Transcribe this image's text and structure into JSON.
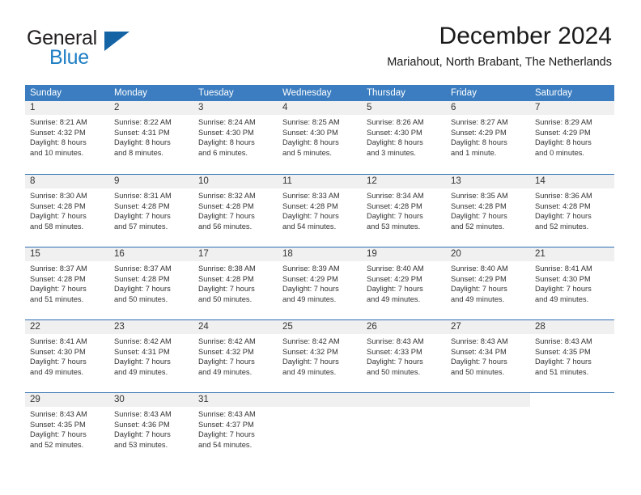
{
  "brand": {
    "word_one": "General",
    "word_two": "Blue",
    "logo_icon": "triangle-logo"
  },
  "header": {
    "title": "December 2024",
    "subtitle": "Mariahout, North Brabant, The Netherlands"
  },
  "colors": {
    "header_blue": "#3b7dc0",
    "rule_blue": "#2f6fb3",
    "band_gray": "#f0f0f0",
    "brand_blue": "#1f7fc4",
    "text": "#333333"
  },
  "weekdays": [
    "Sunday",
    "Monday",
    "Tuesday",
    "Wednesday",
    "Thursday",
    "Friday",
    "Saturday"
  ],
  "weeks": [
    [
      {
        "day": "1",
        "sunrise": "Sunrise: 8:21 AM",
        "sunset": "Sunset: 4:32 PM",
        "daylight1": "Daylight: 8 hours",
        "daylight2": "and 10 minutes."
      },
      {
        "day": "2",
        "sunrise": "Sunrise: 8:22 AM",
        "sunset": "Sunset: 4:31 PM",
        "daylight1": "Daylight: 8 hours",
        "daylight2": "and 8 minutes."
      },
      {
        "day": "3",
        "sunrise": "Sunrise: 8:24 AM",
        "sunset": "Sunset: 4:30 PM",
        "daylight1": "Daylight: 8 hours",
        "daylight2": "and 6 minutes."
      },
      {
        "day": "4",
        "sunrise": "Sunrise: 8:25 AM",
        "sunset": "Sunset: 4:30 PM",
        "daylight1": "Daylight: 8 hours",
        "daylight2": "and 5 minutes."
      },
      {
        "day": "5",
        "sunrise": "Sunrise: 8:26 AM",
        "sunset": "Sunset: 4:30 PM",
        "daylight1": "Daylight: 8 hours",
        "daylight2": "and 3 minutes."
      },
      {
        "day": "6",
        "sunrise": "Sunrise: 8:27 AM",
        "sunset": "Sunset: 4:29 PM",
        "daylight1": "Daylight: 8 hours",
        "daylight2": "and 1 minute."
      },
      {
        "day": "7",
        "sunrise": "Sunrise: 8:29 AM",
        "sunset": "Sunset: 4:29 PM",
        "daylight1": "Daylight: 8 hours",
        "daylight2": "and 0 minutes."
      }
    ],
    [
      {
        "day": "8",
        "sunrise": "Sunrise: 8:30 AM",
        "sunset": "Sunset: 4:28 PM",
        "daylight1": "Daylight: 7 hours",
        "daylight2": "and 58 minutes."
      },
      {
        "day": "9",
        "sunrise": "Sunrise: 8:31 AM",
        "sunset": "Sunset: 4:28 PM",
        "daylight1": "Daylight: 7 hours",
        "daylight2": "and 57 minutes."
      },
      {
        "day": "10",
        "sunrise": "Sunrise: 8:32 AM",
        "sunset": "Sunset: 4:28 PM",
        "daylight1": "Daylight: 7 hours",
        "daylight2": "and 56 minutes."
      },
      {
        "day": "11",
        "sunrise": "Sunrise: 8:33 AM",
        "sunset": "Sunset: 4:28 PM",
        "daylight1": "Daylight: 7 hours",
        "daylight2": "and 54 minutes."
      },
      {
        "day": "12",
        "sunrise": "Sunrise: 8:34 AM",
        "sunset": "Sunset: 4:28 PM",
        "daylight1": "Daylight: 7 hours",
        "daylight2": "and 53 minutes."
      },
      {
        "day": "13",
        "sunrise": "Sunrise: 8:35 AM",
        "sunset": "Sunset: 4:28 PM",
        "daylight1": "Daylight: 7 hours",
        "daylight2": "and 52 minutes."
      },
      {
        "day": "14",
        "sunrise": "Sunrise: 8:36 AM",
        "sunset": "Sunset: 4:28 PM",
        "daylight1": "Daylight: 7 hours",
        "daylight2": "and 52 minutes."
      }
    ],
    [
      {
        "day": "15",
        "sunrise": "Sunrise: 8:37 AM",
        "sunset": "Sunset: 4:28 PM",
        "daylight1": "Daylight: 7 hours",
        "daylight2": "and 51 minutes."
      },
      {
        "day": "16",
        "sunrise": "Sunrise: 8:37 AM",
        "sunset": "Sunset: 4:28 PM",
        "daylight1": "Daylight: 7 hours",
        "daylight2": "and 50 minutes."
      },
      {
        "day": "17",
        "sunrise": "Sunrise: 8:38 AM",
        "sunset": "Sunset: 4:28 PM",
        "daylight1": "Daylight: 7 hours",
        "daylight2": "and 50 minutes."
      },
      {
        "day": "18",
        "sunrise": "Sunrise: 8:39 AM",
        "sunset": "Sunset: 4:29 PM",
        "daylight1": "Daylight: 7 hours",
        "daylight2": "and 49 minutes."
      },
      {
        "day": "19",
        "sunrise": "Sunrise: 8:40 AM",
        "sunset": "Sunset: 4:29 PM",
        "daylight1": "Daylight: 7 hours",
        "daylight2": "and 49 minutes."
      },
      {
        "day": "20",
        "sunrise": "Sunrise: 8:40 AM",
        "sunset": "Sunset: 4:29 PM",
        "daylight1": "Daylight: 7 hours",
        "daylight2": "and 49 minutes."
      },
      {
        "day": "21",
        "sunrise": "Sunrise: 8:41 AM",
        "sunset": "Sunset: 4:30 PM",
        "daylight1": "Daylight: 7 hours",
        "daylight2": "and 49 minutes."
      }
    ],
    [
      {
        "day": "22",
        "sunrise": "Sunrise: 8:41 AM",
        "sunset": "Sunset: 4:30 PM",
        "daylight1": "Daylight: 7 hours",
        "daylight2": "and 49 minutes."
      },
      {
        "day": "23",
        "sunrise": "Sunrise: 8:42 AM",
        "sunset": "Sunset: 4:31 PM",
        "daylight1": "Daylight: 7 hours",
        "daylight2": "and 49 minutes."
      },
      {
        "day": "24",
        "sunrise": "Sunrise: 8:42 AM",
        "sunset": "Sunset: 4:32 PM",
        "daylight1": "Daylight: 7 hours",
        "daylight2": "and 49 minutes."
      },
      {
        "day": "25",
        "sunrise": "Sunrise: 8:42 AM",
        "sunset": "Sunset: 4:32 PM",
        "daylight1": "Daylight: 7 hours",
        "daylight2": "and 49 minutes."
      },
      {
        "day": "26",
        "sunrise": "Sunrise: 8:43 AM",
        "sunset": "Sunset: 4:33 PM",
        "daylight1": "Daylight: 7 hours",
        "daylight2": "and 50 minutes."
      },
      {
        "day": "27",
        "sunrise": "Sunrise: 8:43 AM",
        "sunset": "Sunset: 4:34 PM",
        "daylight1": "Daylight: 7 hours",
        "daylight2": "and 50 minutes."
      },
      {
        "day": "28",
        "sunrise": "Sunrise: 8:43 AM",
        "sunset": "Sunset: 4:35 PM",
        "daylight1": "Daylight: 7 hours",
        "daylight2": "and 51 minutes."
      }
    ],
    [
      {
        "day": "29",
        "sunrise": "Sunrise: 8:43 AM",
        "sunset": "Sunset: 4:35 PM",
        "daylight1": "Daylight: 7 hours",
        "daylight2": "and 52 minutes."
      },
      {
        "day": "30",
        "sunrise": "Sunrise: 8:43 AM",
        "sunset": "Sunset: 4:36 PM",
        "daylight1": "Daylight: 7 hours",
        "daylight2": "and 53 minutes."
      },
      {
        "day": "31",
        "sunrise": "Sunrise: 8:43 AM",
        "sunset": "Sunset: 4:37 PM",
        "daylight1": "Daylight: 7 hours",
        "daylight2": "and 54 minutes."
      },
      {
        "day": "",
        "sunrise": "",
        "sunset": "",
        "daylight1": "",
        "daylight2": ""
      },
      {
        "day": "",
        "sunrise": "",
        "sunset": "",
        "daylight1": "",
        "daylight2": ""
      },
      {
        "day": "",
        "sunrise": "",
        "sunset": "",
        "daylight1": "",
        "daylight2": ""
      },
      {
        "day": "",
        "sunrise": "",
        "sunset": "",
        "daylight1": "",
        "daylight2": ""
      }
    ]
  ]
}
